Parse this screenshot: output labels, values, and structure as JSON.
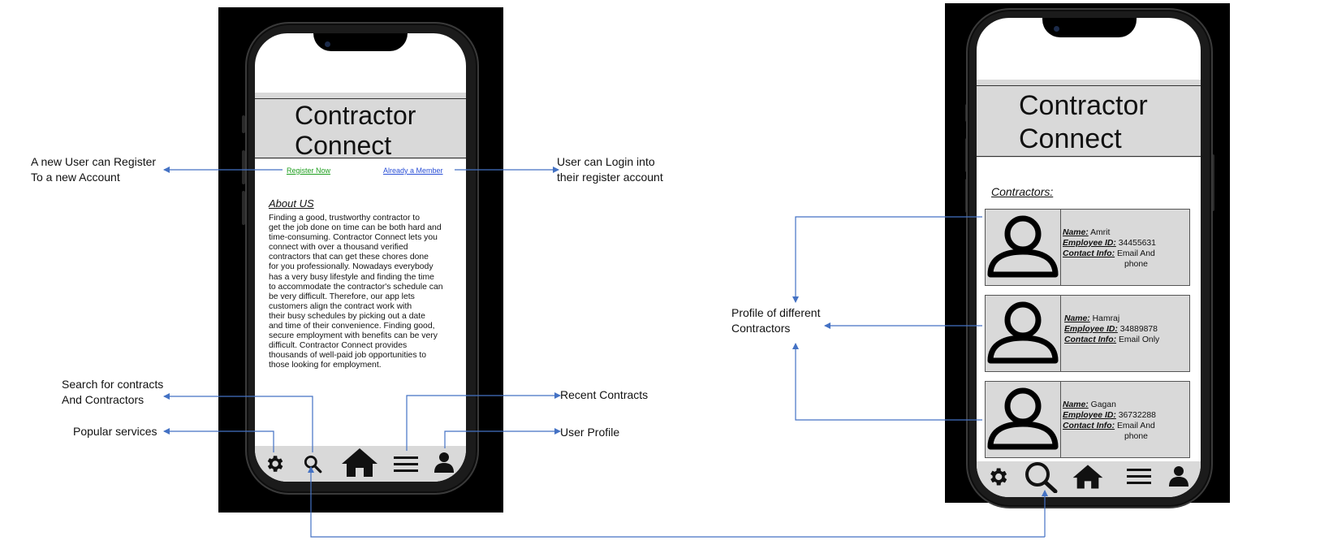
{
  "app_title": "Contractor Connect",
  "screen1": {
    "title_line1": "Contractor",
    "title_line2": "Connect",
    "register_link": "Register Now",
    "member_link": "Already a Member",
    "about_heading": "About US",
    "about_text": "Finding a good, trustworthy contractor to\nget the job done on time can be both hard and\ntime-consuming. Contractor Connect lets you\nconnect with over a thousand verified\ncontractors that can get these chores done\nfor you professionally. Nowadays everybody\nhas a very busy lifestyle and finding the time\nto accommodate the contractor's schedule can\nbe very difficult. Therefore, our app lets\ncustomers align the contract work with\ntheir busy schedules by picking out a date\nand time of their convenience. Finding good,\nsecure employment with benefits can be very\ndifficult. Contractor Connect provides\nthousands of well-paid job opportunities to\nthose looking for employment."
  },
  "screen2": {
    "title_line1": "Contractor",
    "title_line2": "Connect",
    "section_heading": "Contractors:",
    "labels": {
      "name": "Name:",
      "employee_id": "Employee ID:",
      "contact": "Contact Info:"
    },
    "contractors": [
      {
        "name": "Amrit",
        "employee_id": "34455631",
        "contact_line1": "Email And",
        "contact_line2": "phone"
      },
      {
        "name": "Hamraj",
        "employee_id": "34889878",
        "contact_line1": "Email Only",
        "contact_line2": ""
      },
      {
        "name": "Gagan",
        "employee_id": "36732288",
        "contact_line1": "Email And",
        "contact_line2": "phone"
      }
    ]
  },
  "nav_icons": [
    "gear-icon",
    "search-icon",
    "home-icon",
    "menu-icon",
    "user-icon"
  ],
  "annotations": {
    "register": "A new User can Register\nTo a new Account",
    "login": "User can Login into\ntheir register account",
    "search": "Search for contracts\nAnd Contractors",
    "popular": "Popular services",
    "recent": "Recent Contracts",
    "profile": "User Profile",
    "profiles_different": "Profile of different\nContractors"
  },
  "colors": {
    "arrow": "#4472c4",
    "header_gray": "#d9d9d9",
    "register_green": "#1e9e1e",
    "member_blue": "#2a4fd6"
  }
}
